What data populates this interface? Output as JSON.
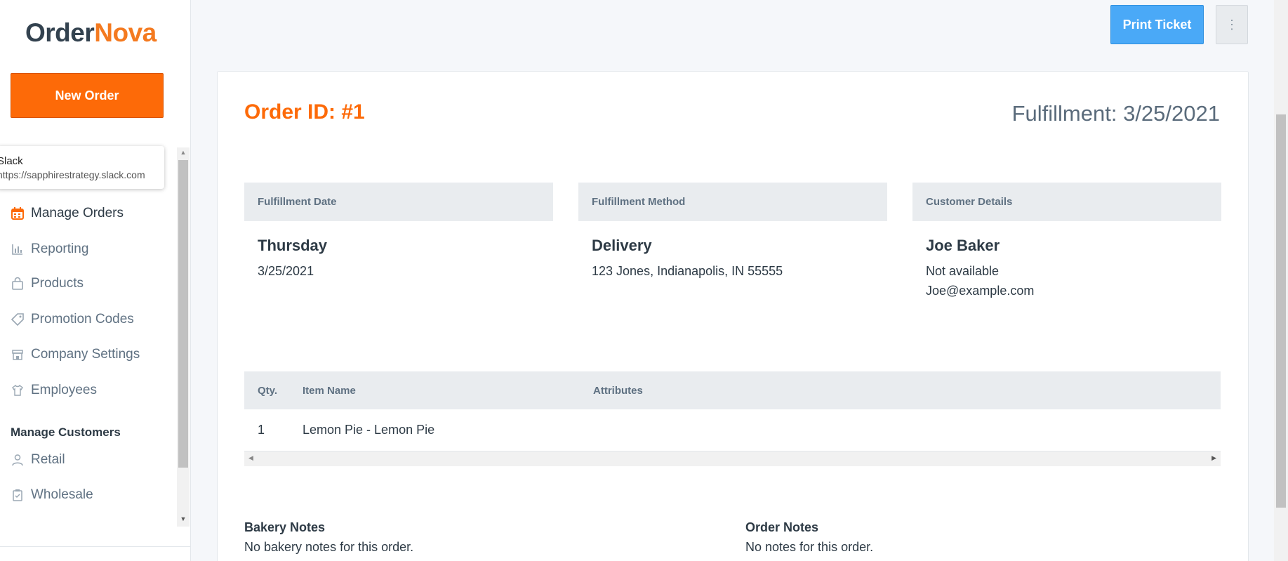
{
  "brand": {
    "part1": "Order",
    "part2": "Nova"
  },
  "sidebar": {
    "new_order_label": "New Order",
    "tooltip": {
      "title": "Slack",
      "url": "https://sapphirestrategy.slack.com"
    },
    "items": [
      {
        "label": "Manage Orders",
        "icon": "calendar-icon"
      },
      {
        "label": "Reporting",
        "icon": "bar-chart-icon"
      },
      {
        "label": "Products",
        "icon": "shopping-bag-icon"
      },
      {
        "label": "Promotion Codes",
        "icon": "tag-icon"
      },
      {
        "label": "Company Settings",
        "icon": "store-icon"
      },
      {
        "label": "Employees",
        "icon": "shirt-icon"
      }
    ],
    "customers_section": {
      "title": "Manage Customers",
      "items": [
        {
          "label": "Retail",
          "icon": "user-icon"
        },
        {
          "label": "Wholesale",
          "icon": "clipboard-check-icon"
        }
      ]
    }
  },
  "toolbar": {
    "print_label": "Print Ticket",
    "more_label": "⋮"
  },
  "order": {
    "id_label": "Order ID: #1",
    "fulfillment_heading": "Fulfillment: 3/25/2021",
    "fulfillment_date": {
      "header": "Fulfillment Date",
      "day": "Thursday",
      "date": "3/25/2021"
    },
    "fulfillment_method": {
      "header": "Fulfillment Method",
      "method": "Delivery",
      "address": "123 Jones, Indianapolis, IN 55555"
    },
    "customer": {
      "header": "Customer Details",
      "name": "Joe Baker",
      "phone": "Not available",
      "email": "Joe@example.com"
    },
    "items_table": {
      "headers": [
        "Qty.",
        "Item Name",
        "Attributes"
      ],
      "rows": [
        {
          "qty": "1",
          "name": "Lemon Pie - Lemon Pie",
          "attributes": ""
        }
      ]
    },
    "bakery_notes": {
      "title": "Bakery Notes",
      "text": "No bakery notes for this order."
    },
    "order_notes": {
      "title": "Order Notes",
      "text": "No notes for this order."
    }
  },
  "colors": {
    "accent": "#fd6a08",
    "primary_button": "#4aa9f7",
    "text": "#2d3a45",
    "muted": "#5f7182"
  }
}
